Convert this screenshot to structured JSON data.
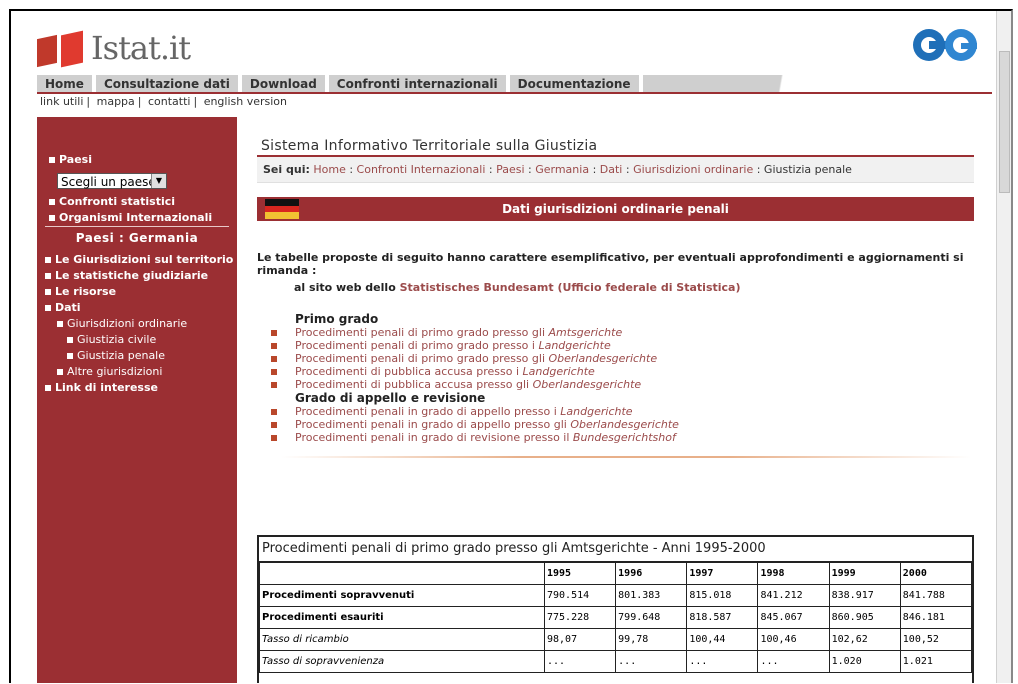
{
  "brand": {
    "logo_text": "Istat.it"
  },
  "nav": {
    "tabs": [
      "Home",
      "Consultazione dati",
      "Download",
      "Confronti internazionali",
      "Documentazione"
    ]
  },
  "utils": [
    "link utili",
    "mappa",
    "contatti",
    "english version"
  ],
  "sidebar": {
    "paesi": "Paesi",
    "select_value": "Scegli un paese",
    "confronti": "Confronti statistici",
    "organismi": "Organismi Internazionali",
    "heading": "Paesi : Germania",
    "items": [
      "Le Giurisdizioni sul territorio",
      "Le statistiche giudiziarie",
      "Le risorse",
      "Dati"
    ],
    "sub_dati": "Giurisdizioni ordinarie",
    "sub_civile": "Giustizia civile",
    "sub_penale": "Giustizia penale",
    "sub_altre": "Altre giurisdizioni",
    "link_interesse": "Link di interesse"
  },
  "main": {
    "title": "Sistema Informativo Territoriale sulla Giustizia",
    "crumb_label": "Sei qui:",
    "crumbs": [
      "Home",
      "Confronti Internazionali",
      "Paesi",
      "Germania",
      "Dati",
      "Giurisdizioni ordinarie",
      "Giustizia penale"
    ],
    "section_title": "Dati giurisdizioni ordinarie penali",
    "intro": "Le tabelle proposte di seguito hanno carattere esemplificativo, per eventuali approfondimenti e aggiornamenti si rimanda :",
    "site_prefix": "al sito web dello",
    "site_link": "Statistisches Bundesamt (Ufficio federale di Statistica)",
    "group1": "Primo grado",
    "group2": "Grado di appello e revisione",
    "links1": [
      {
        "text": "Procedimenti penali di primo grado presso gli ",
        "em": "Amtsgerichte"
      },
      {
        "text": "Procedimenti penali di primo grado presso i ",
        "em": "Landgerichte"
      },
      {
        "text": "Procedimenti penali di primo grado presso gli ",
        "em": "Oberlandesgerichte"
      },
      {
        "text": "Procedimenti di pubblica accusa presso i ",
        "em": "Landgerichte"
      },
      {
        "text": "Procedimenti di pubblica accusa presso gli ",
        "em": "Oberlandesgerichte"
      }
    ],
    "links2": [
      {
        "text": "Procedimenti penali in grado di appello presso i ",
        "em": "Landgerichte"
      },
      {
        "text": "Procedimenti penali in grado di appello presso gli ",
        "em": "Oberlandesgerichte"
      },
      {
        "text": "Procedimenti penali in grado di revisione presso il ",
        "em": "Bundesgerichtshof"
      }
    ]
  },
  "table": {
    "caption": "Procedimenti penali di primo grado presso gli Amtsgerichte - Anni 1995-2000",
    "years": [
      "1995",
      "1996",
      "1997",
      "1998",
      "1999",
      "2000"
    ],
    "rows": [
      {
        "label": "Procedimenti sopravvenuti",
        "style": "bold",
        "values": [
          "790.514",
          "801.383",
          "815.018",
          "841.212",
          "838.917",
          "841.788"
        ]
      },
      {
        "label": "Procedimenti esauriti",
        "style": "bold",
        "values": [
          "775.228",
          "799.648",
          "818.587",
          "845.067",
          "860.905",
          "846.181"
        ]
      },
      {
        "label": "Tasso di ricambio",
        "style": "italic",
        "values": [
          "98,07",
          "99,78",
          "100,44",
          "100,46",
          "102,62",
          "100,52"
        ]
      },
      {
        "label": "Tasso di sopravvenienza",
        "style": "italic",
        "values": [
          "...",
          "...",
          "...",
          "...",
          "1.020",
          "1.021"
        ]
      }
    ]
  },
  "colors": {
    "brand_red": "#9b2f33",
    "link": "#9b4b4b",
    "bullet": "#b9472b"
  }
}
